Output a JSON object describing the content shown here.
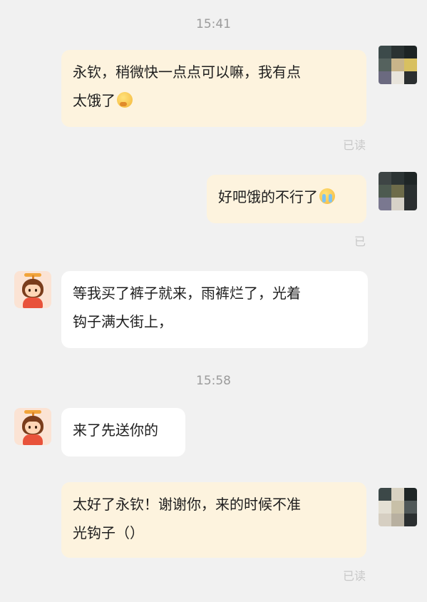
{
  "timestamps": [
    "15:41",
    "15:58"
  ],
  "messages": [
    {
      "side": "out",
      "lines": [
        "永钦，稍微快一点点可以嘛，我有点",
        "太饿了"
      ],
      "emoji": "thinking-face-emoji"
    },
    {
      "side": "out",
      "lines": [
        "好吧饿的不行了"
      ],
      "emoji": "loudly-crying-face-emoji"
    },
    {
      "side": "in",
      "lines": [
        "等我买了裤子就来，雨裤烂了，光着",
        "钩子满大街上，"
      ]
    },
    {
      "side": "in",
      "lines": [
        "来了先送你的"
      ]
    },
    {
      "side": "out",
      "lines": [
        "太好了永钦！谢谢你，来的时候不准",
        "光钩子（）"
      ]
    }
  ],
  "read_receipts": [
    "已读",
    "已",
    "已读"
  ],
  "colors": {
    "background": "#f1f1f1",
    "outgoing_bubble": "#fdf3de",
    "incoming_bubble": "#ffffff",
    "timestamp_text": "#9b9b9b",
    "read_text": "#c8c8c8"
  }
}
